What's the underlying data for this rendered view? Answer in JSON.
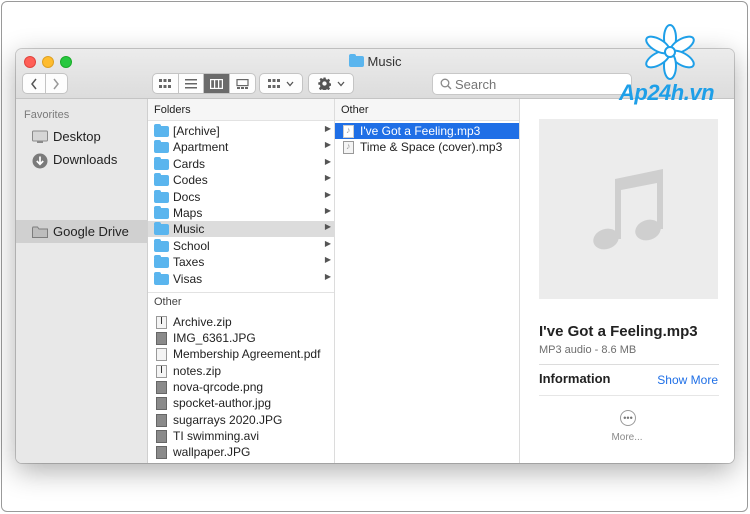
{
  "window": {
    "title": "Music"
  },
  "toolbar": {
    "back_icon": "chevron-left-icon",
    "forward_icon": "chevron-right-icon",
    "view_modes": [
      "icon-view",
      "list-view",
      "column-view",
      "gallery-view"
    ],
    "active_view": "column-view",
    "search_placeholder": "Search"
  },
  "sidebar": {
    "heading": "Favorites",
    "items": [
      {
        "label": "Desktop",
        "icon": "desktop-icon"
      },
      {
        "label": "Downloads",
        "icon": "download-icon"
      },
      {
        "label": "Google Drive",
        "icon": "drive-folder-icon",
        "selected": true
      }
    ]
  },
  "folders_column": {
    "heading": "Folders",
    "folders": [
      "[Archive]",
      "Apartment",
      "Cards",
      "Codes",
      "Docs",
      "Maps",
      "Music",
      "School",
      "Taxes",
      "Visas"
    ],
    "selected": "Music",
    "other_heading": "Other",
    "files": [
      "Archive.zip",
      "IMG_6361.JPG",
      "Membership Agreement.pdf",
      "notes.zip",
      "nova-qrcode.png",
      "spocket-author.jpg",
      "sugarrays 2020.JPG",
      "TI swimming.avi",
      "wallpaper.JPG"
    ]
  },
  "music_column": {
    "heading": "Other",
    "files": [
      "I've Got a Feeling.mp3",
      "Time & Space (cover).mp3"
    ],
    "selected": "I've Got a Feeling.mp3"
  },
  "preview": {
    "name": "I've Got a Feeling.mp3",
    "subtitle": "MP3 audio - 8.6 MB",
    "info_label": "Information",
    "show_more": "Show More",
    "more_label": "More..."
  },
  "watermark": {
    "text": "Ap24h.vn"
  },
  "colors": {
    "accent": "#1f6fe6",
    "folder": "#5ab5ee",
    "watermark": "#1e9fe8"
  }
}
